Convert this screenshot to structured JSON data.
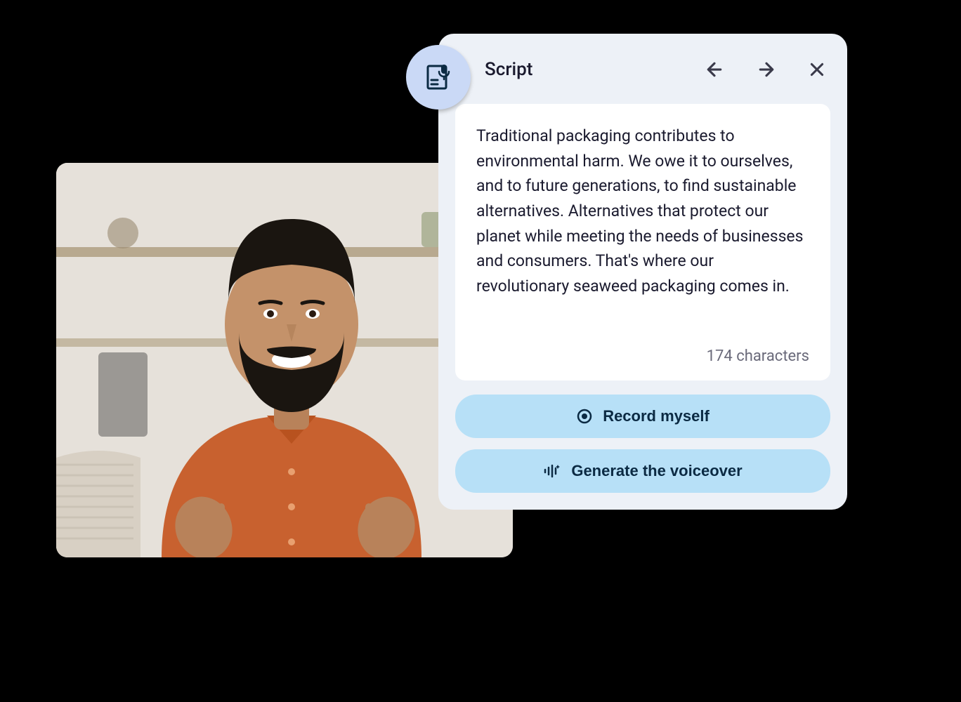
{
  "panel": {
    "title": "Script",
    "icon": "script-mic-icon"
  },
  "script": {
    "text": "Traditional packaging contributes to environmental harm. We owe it to ourselves, and to future generations, to find sustainable alternatives. Alternatives that protect our planet while meeting the needs of businesses and consumers. That's where our revolutionary seaweed packaging comes in.",
    "char_count": "174 characters"
  },
  "actions": {
    "record": "Record myself",
    "generate": "Generate the voiceover"
  },
  "nav": {
    "back": "back",
    "forward": "forward",
    "close": "close"
  },
  "colors": {
    "panel_bg": "#edf1f7",
    "badge_bg": "#cad9f6",
    "button_bg": "#b7e0f7",
    "text_dark": "#0b2a43"
  }
}
